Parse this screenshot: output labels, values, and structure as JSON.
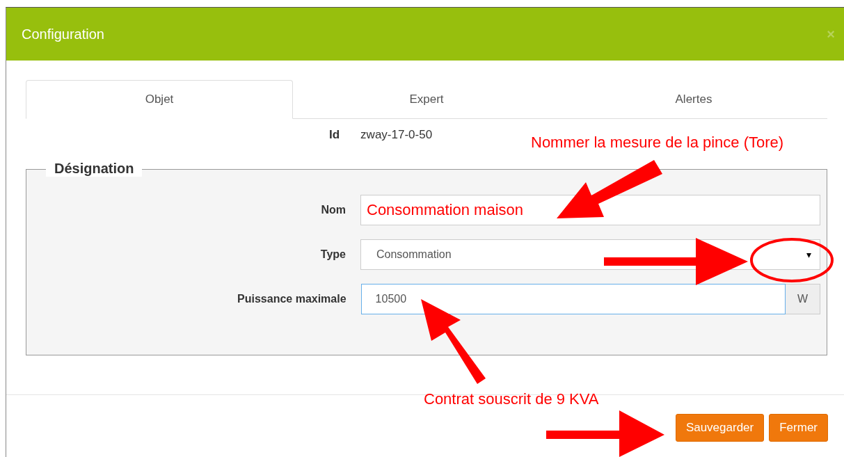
{
  "dialog": {
    "title": "Configuration",
    "close": "×"
  },
  "tabs": [
    {
      "label": "Objet",
      "selected": true
    },
    {
      "label": "Expert",
      "selected": false
    },
    {
      "label": "Alertes",
      "selected": false
    }
  ],
  "id_row": {
    "label": "Id",
    "value": "zway-17-0-50"
  },
  "fieldset": {
    "legend": "Désignation",
    "fields": [
      {
        "kind": "text",
        "label": "Nom",
        "value": "Consommation maison"
      },
      {
        "kind": "select",
        "label": "Type",
        "value": "Consommation",
        "caret": "▾"
      },
      {
        "kind": "unit",
        "label": "Puissance maximale",
        "value": "10500",
        "unit": "W"
      }
    ]
  },
  "annotations": [
    "Nommer la mesure de la pince (Tore)",
    "Contrat souscrit de 9 KVA"
  ],
  "buttons": [
    "Sauvegarder",
    "Fermer"
  ]
}
